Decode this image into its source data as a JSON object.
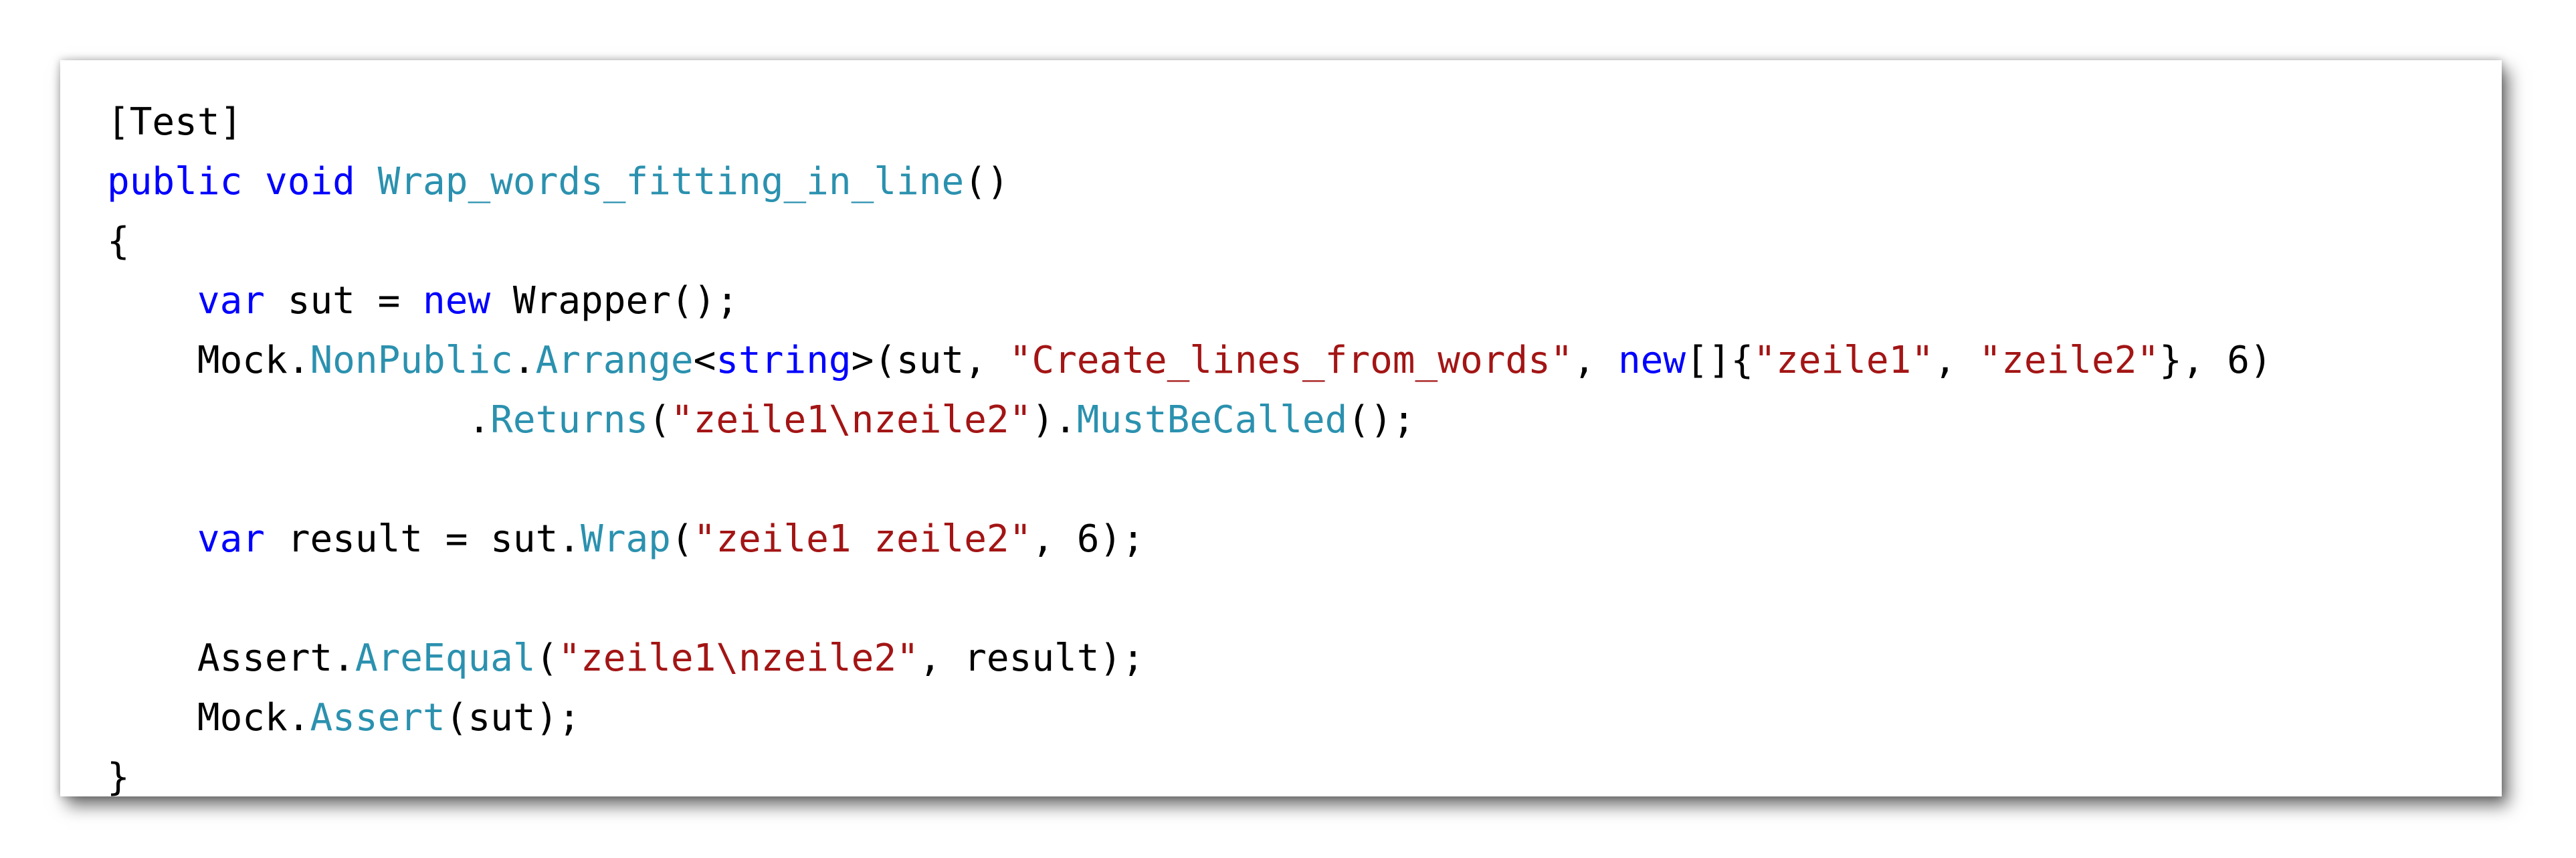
{
  "editor": {
    "colors": {
      "keyword": "#0000ff",
      "type": "#2b91af",
      "string": "#a31515",
      "text": "#000000",
      "background": "#ffffff"
    },
    "lines": [
      [
        {
          "t": "plain",
          "v": "[Test]"
        }
      ],
      [
        {
          "t": "kw",
          "v": "public"
        },
        {
          "t": "plain",
          "v": " "
        },
        {
          "t": "kw",
          "v": "void"
        },
        {
          "t": "plain",
          "v": " "
        },
        {
          "t": "type",
          "v": "Wrap_words_fitting_in_line"
        },
        {
          "t": "plain",
          "v": "()"
        }
      ],
      [
        {
          "t": "plain",
          "v": "{"
        }
      ],
      [
        {
          "t": "plain",
          "v": "    "
        },
        {
          "t": "kw",
          "v": "var"
        },
        {
          "t": "plain",
          "v": " sut = "
        },
        {
          "t": "kw",
          "v": "new"
        },
        {
          "t": "plain",
          "v": " Wrapper();"
        }
      ],
      [
        {
          "t": "plain",
          "v": "    Mock."
        },
        {
          "t": "type",
          "v": "NonPublic"
        },
        {
          "t": "plain",
          "v": "."
        },
        {
          "t": "type",
          "v": "Arrange"
        },
        {
          "t": "plain",
          "v": "<"
        },
        {
          "t": "kw",
          "v": "string"
        },
        {
          "t": "plain",
          "v": ">(sut, "
        },
        {
          "t": "str",
          "v": "\"Create_lines_from_words\""
        },
        {
          "t": "plain",
          "v": ", "
        },
        {
          "t": "kw",
          "v": "new"
        },
        {
          "t": "plain",
          "v": "[]{"
        },
        {
          "t": "str",
          "v": "\"zeile1\""
        },
        {
          "t": "plain",
          "v": ", "
        },
        {
          "t": "str",
          "v": "\"zeile2\""
        },
        {
          "t": "plain",
          "v": "}, 6)"
        }
      ],
      [
        {
          "t": "plain",
          "v": "                ."
        },
        {
          "t": "type",
          "v": "Returns"
        },
        {
          "t": "plain",
          "v": "("
        },
        {
          "t": "str",
          "v": "\"zeile1\\nzeile2\""
        },
        {
          "t": "plain",
          "v": ")."
        },
        {
          "t": "type",
          "v": "MustBeCalled"
        },
        {
          "t": "plain",
          "v": "();"
        }
      ],
      [
        {
          "t": "plain",
          "v": ""
        }
      ],
      [
        {
          "t": "plain",
          "v": "    "
        },
        {
          "t": "kw",
          "v": "var"
        },
        {
          "t": "plain",
          "v": " result = sut."
        },
        {
          "t": "type",
          "v": "Wrap"
        },
        {
          "t": "plain",
          "v": "("
        },
        {
          "t": "str",
          "v": "\"zeile1 zeile2\""
        },
        {
          "t": "plain",
          "v": ", 6);"
        }
      ],
      [
        {
          "t": "plain",
          "v": ""
        }
      ],
      [
        {
          "t": "plain",
          "v": "    Assert."
        },
        {
          "t": "type",
          "v": "AreEqual"
        },
        {
          "t": "plain",
          "v": "("
        },
        {
          "t": "str",
          "v": "\"zeile1\\nzeile2\""
        },
        {
          "t": "plain",
          "v": ", result);"
        }
      ],
      [
        {
          "t": "plain",
          "v": "    Mock."
        },
        {
          "t": "type",
          "v": "Assert"
        },
        {
          "t": "plain",
          "v": "(sut);"
        }
      ],
      [
        {
          "t": "plain",
          "v": "}"
        }
      ]
    ]
  }
}
